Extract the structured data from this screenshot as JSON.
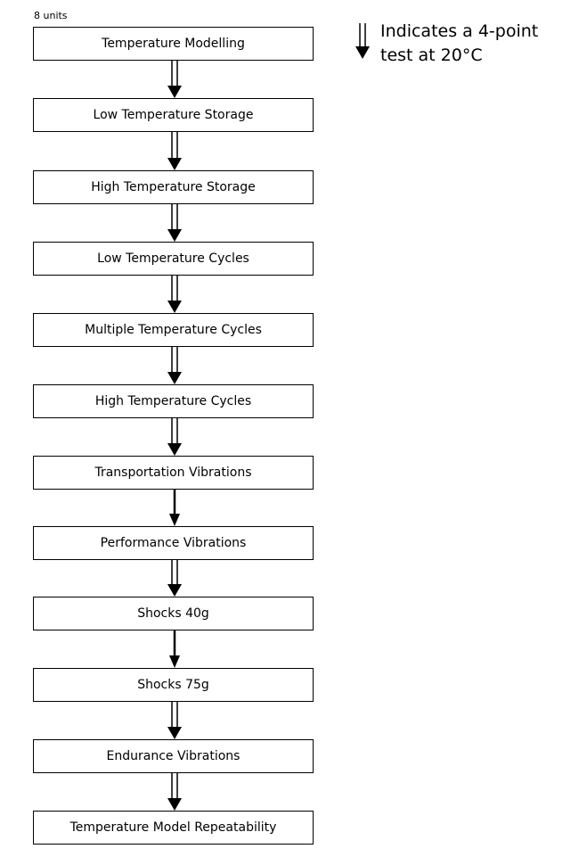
{
  "header": {
    "units_label": "8 units"
  },
  "legend": {
    "arrow_type": "double",
    "line1": "Indicates a 4-point",
    "line2": "test at 20°C"
  },
  "steps": [
    {
      "label": "Temperature Modelling"
    },
    {
      "label": "Low Temperature Storage"
    },
    {
      "label": "High Temperature Storage"
    },
    {
      "label": "Low Temperature Cycles"
    },
    {
      "label": "Multiple Temperature Cycles"
    },
    {
      "label": "High Temperature Cycles"
    },
    {
      "label": "Transportation Vibrations"
    },
    {
      "label": "Performance Vibrations"
    },
    {
      "label": "Shocks 40g"
    },
    {
      "label": "Shocks 75g"
    },
    {
      "label": "Endurance Vibrations"
    },
    {
      "label": "Temperature Model Repeatability"
    }
  ],
  "connections": [
    "double",
    "double",
    "double",
    "double",
    "double",
    "double",
    "single",
    "double",
    "single",
    "double",
    "double"
  ]
}
